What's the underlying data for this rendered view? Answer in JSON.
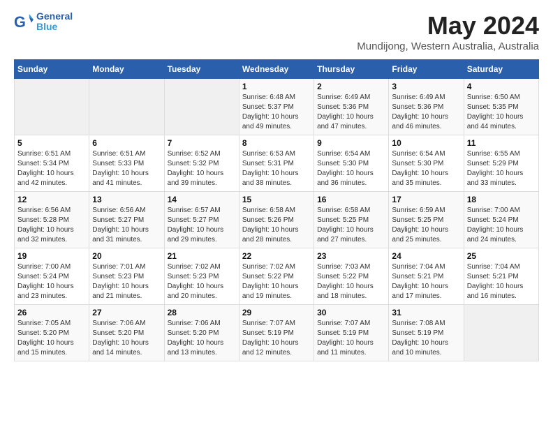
{
  "header": {
    "logo_line1": "General",
    "logo_line2": "Blue",
    "title": "May 2024",
    "subtitle": "Mundijong, Western Australia, Australia"
  },
  "calendar": {
    "days_of_week": [
      "Sunday",
      "Monday",
      "Tuesday",
      "Wednesday",
      "Thursday",
      "Friday",
      "Saturday"
    ],
    "weeks": [
      [
        {
          "day": "",
          "info": ""
        },
        {
          "day": "",
          "info": ""
        },
        {
          "day": "",
          "info": ""
        },
        {
          "day": "1",
          "info": "Sunrise: 6:48 AM\nSunset: 5:37 PM\nDaylight: 10 hours\nand 49 minutes."
        },
        {
          "day": "2",
          "info": "Sunrise: 6:49 AM\nSunset: 5:36 PM\nDaylight: 10 hours\nand 47 minutes."
        },
        {
          "day": "3",
          "info": "Sunrise: 6:49 AM\nSunset: 5:36 PM\nDaylight: 10 hours\nand 46 minutes."
        },
        {
          "day": "4",
          "info": "Sunrise: 6:50 AM\nSunset: 5:35 PM\nDaylight: 10 hours\nand 44 minutes."
        }
      ],
      [
        {
          "day": "5",
          "info": "Sunrise: 6:51 AM\nSunset: 5:34 PM\nDaylight: 10 hours\nand 42 minutes."
        },
        {
          "day": "6",
          "info": "Sunrise: 6:51 AM\nSunset: 5:33 PM\nDaylight: 10 hours\nand 41 minutes."
        },
        {
          "day": "7",
          "info": "Sunrise: 6:52 AM\nSunset: 5:32 PM\nDaylight: 10 hours\nand 39 minutes."
        },
        {
          "day": "8",
          "info": "Sunrise: 6:53 AM\nSunset: 5:31 PM\nDaylight: 10 hours\nand 38 minutes."
        },
        {
          "day": "9",
          "info": "Sunrise: 6:54 AM\nSunset: 5:30 PM\nDaylight: 10 hours\nand 36 minutes."
        },
        {
          "day": "10",
          "info": "Sunrise: 6:54 AM\nSunset: 5:30 PM\nDaylight: 10 hours\nand 35 minutes."
        },
        {
          "day": "11",
          "info": "Sunrise: 6:55 AM\nSunset: 5:29 PM\nDaylight: 10 hours\nand 33 minutes."
        }
      ],
      [
        {
          "day": "12",
          "info": "Sunrise: 6:56 AM\nSunset: 5:28 PM\nDaylight: 10 hours\nand 32 minutes."
        },
        {
          "day": "13",
          "info": "Sunrise: 6:56 AM\nSunset: 5:27 PM\nDaylight: 10 hours\nand 31 minutes."
        },
        {
          "day": "14",
          "info": "Sunrise: 6:57 AM\nSunset: 5:27 PM\nDaylight: 10 hours\nand 29 minutes."
        },
        {
          "day": "15",
          "info": "Sunrise: 6:58 AM\nSunset: 5:26 PM\nDaylight: 10 hours\nand 28 minutes."
        },
        {
          "day": "16",
          "info": "Sunrise: 6:58 AM\nSunset: 5:25 PM\nDaylight: 10 hours\nand 27 minutes."
        },
        {
          "day": "17",
          "info": "Sunrise: 6:59 AM\nSunset: 5:25 PM\nDaylight: 10 hours\nand 25 minutes."
        },
        {
          "day": "18",
          "info": "Sunrise: 7:00 AM\nSunset: 5:24 PM\nDaylight: 10 hours\nand 24 minutes."
        }
      ],
      [
        {
          "day": "19",
          "info": "Sunrise: 7:00 AM\nSunset: 5:24 PM\nDaylight: 10 hours\nand 23 minutes."
        },
        {
          "day": "20",
          "info": "Sunrise: 7:01 AM\nSunset: 5:23 PM\nDaylight: 10 hours\nand 21 minutes."
        },
        {
          "day": "21",
          "info": "Sunrise: 7:02 AM\nSunset: 5:23 PM\nDaylight: 10 hours\nand 20 minutes."
        },
        {
          "day": "22",
          "info": "Sunrise: 7:02 AM\nSunset: 5:22 PM\nDaylight: 10 hours\nand 19 minutes."
        },
        {
          "day": "23",
          "info": "Sunrise: 7:03 AM\nSunset: 5:22 PM\nDaylight: 10 hours\nand 18 minutes."
        },
        {
          "day": "24",
          "info": "Sunrise: 7:04 AM\nSunset: 5:21 PM\nDaylight: 10 hours\nand 17 minutes."
        },
        {
          "day": "25",
          "info": "Sunrise: 7:04 AM\nSunset: 5:21 PM\nDaylight: 10 hours\nand 16 minutes."
        }
      ],
      [
        {
          "day": "26",
          "info": "Sunrise: 7:05 AM\nSunset: 5:20 PM\nDaylight: 10 hours\nand 15 minutes."
        },
        {
          "day": "27",
          "info": "Sunrise: 7:06 AM\nSunset: 5:20 PM\nDaylight: 10 hours\nand 14 minutes."
        },
        {
          "day": "28",
          "info": "Sunrise: 7:06 AM\nSunset: 5:20 PM\nDaylight: 10 hours\nand 13 minutes."
        },
        {
          "day": "29",
          "info": "Sunrise: 7:07 AM\nSunset: 5:19 PM\nDaylight: 10 hours\nand 12 minutes."
        },
        {
          "day": "30",
          "info": "Sunrise: 7:07 AM\nSunset: 5:19 PM\nDaylight: 10 hours\nand 11 minutes."
        },
        {
          "day": "31",
          "info": "Sunrise: 7:08 AM\nSunset: 5:19 PM\nDaylight: 10 hours\nand 10 minutes."
        },
        {
          "day": "",
          "info": ""
        }
      ]
    ]
  }
}
